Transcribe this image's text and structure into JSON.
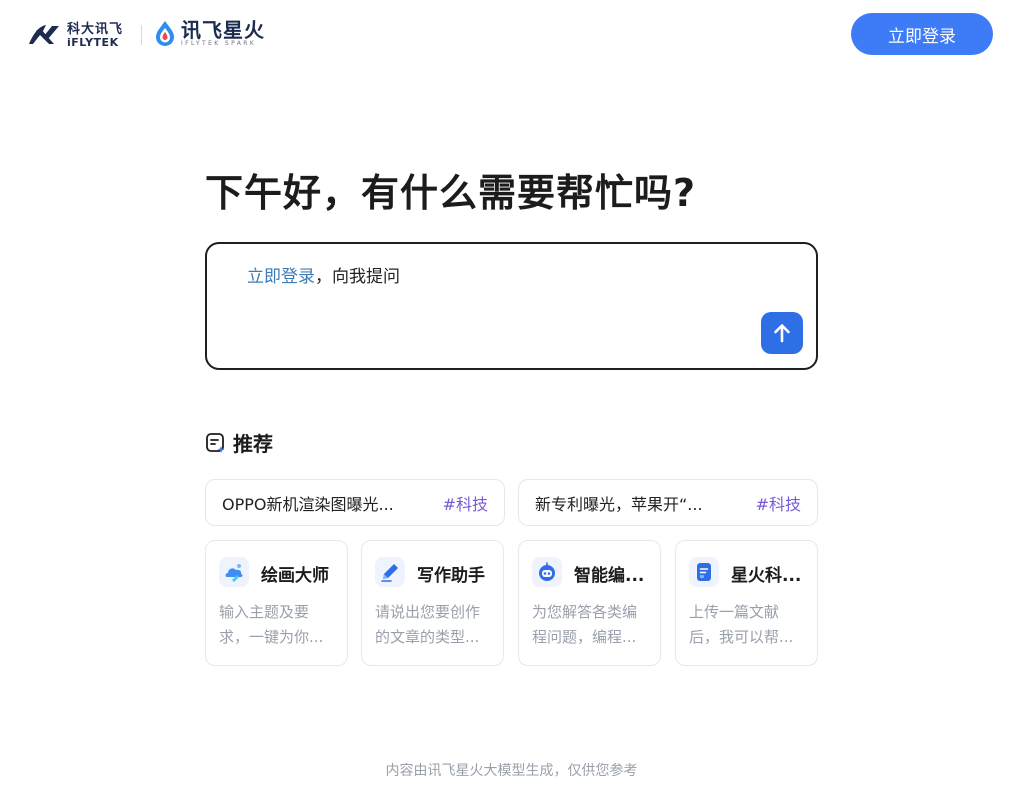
{
  "header": {
    "brand_iflytek_cn": "科大讯飞",
    "brand_iflytek_en": "iFLYTEK",
    "brand_spark_cn": "讯飞星火",
    "brand_spark_en": "IFLYTEK SPARK",
    "login_label": "立即登录"
  },
  "greeting": "下午好，有什么需要帮忙吗?",
  "ask": {
    "login_link": "立即登录",
    "prompt_suffix": "，向我提问",
    "send_icon": "arrow-up-icon"
  },
  "recommend": {
    "title": "推荐",
    "topics": [
      {
        "text": "OPPO新机渲染图曝光...",
        "tag": "#科技"
      },
      {
        "text": "新专利曝光，苹果开“...",
        "tag": "#科技"
      }
    ],
    "agents": [
      {
        "name": "绘画大师",
        "desc": "输入主题及要求，一键为你...",
        "icon": "paint-icon"
      },
      {
        "name": "写作助手",
        "desc": "请说出您要创作的文章的类型...",
        "icon": "pen-icon"
      },
      {
        "name": "智能编...",
        "desc": "为您解答各类编程问题，编程...",
        "icon": "robot-icon"
      },
      {
        "name": "星火科...",
        "desc": "上传一篇文献后，我可以帮...",
        "icon": "document-icon"
      }
    ]
  },
  "footer_note": "内容由讯飞星火大模型生成，仅供您参考",
  "colors": {
    "primary": "#3d7bf7",
    "send": "#2f6fe6",
    "link": "#3d7bb8",
    "tag": "#7a5ad6"
  }
}
